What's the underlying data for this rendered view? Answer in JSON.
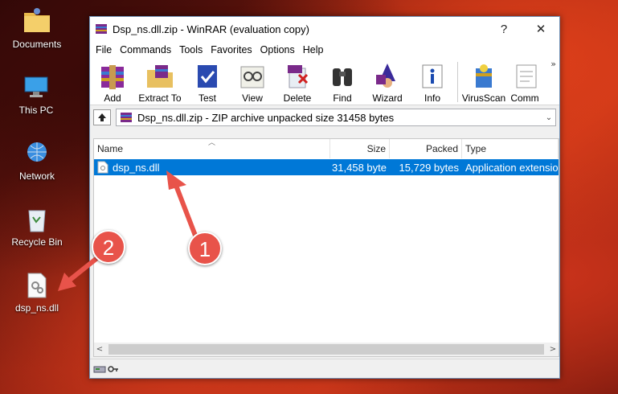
{
  "desktop": {
    "icons": [
      {
        "label": "Documents"
      },
      {
        "label": "This PC"
      },
      {
        "label": "Network"
      },
      {
        "label": "Recycle Bin"
      },
      {
        "label": "dsp_ns.dll"
      }
    ]
  },
  "window": {
    "title": "Dsp_ns.dll.zip - WinRAR (evaluation copy)",
    "help_glyph": "?",
    "close_glyph": "✕"
  },
  "menu": [
    "File",
    "Commands",
    "Tools",
    "Favorites",
    "Options",
    "Help"
  ],
  "toolbar": [
    "Add",
    "Extract To",
    "Test",
    "View",
    "Delete",
    "Find",
    "Wizard",
    "Info",
    "VirusScan",
    "Comm"
  ],
  "toolbar_more": "»",
  "path": {
    "text": "Dsp_ns.dll.zip - ZIP archive unpacked size 31458 bytes",
    "dropdown": "⌄"
  },
  "columns": {
    "name": "Name",
    "size": "Size",
    "packed": "Packed",
    "type": "Type"
  },
  "files": [
    {
      "name": "dsp_ns.dll",
      "size": "31,458 byte",
      "packed": "15,729 bytes",
      "type": "Application extensio"
    }
  ],
  "scroll": {
    "left": "<",
    "right": ">"
  },
  "annotations": {
    "badge1": "1",
    "badge2": "2"
  },
  "colors": {
    "accent": "#0078d7",
    "badge": "#e8534a"
  }
}
